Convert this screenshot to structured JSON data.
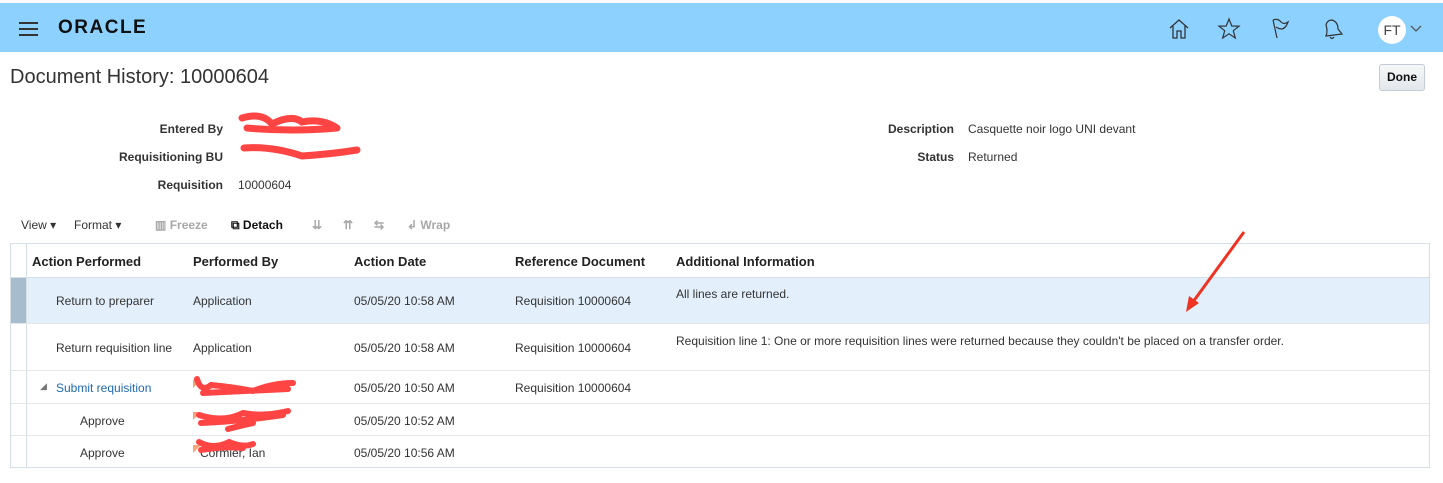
{
  "header": {
    "logo": "ORACLE",
    "avatar": "FT",
    "icons": [
      "menu-icon",
      "home-icon",
      "favorites-star-icon",
      "flag-icon",
      "notifications-bell-icon",
      "chevron-down-icon"
    ]
  },
  "page": {
    "title": "Document History: 10000604",
    "done_label": "Done"
  },
  "form": {
    "left": [
      {
        "label": "Entered By",
        "value": ""
      },
      {
        "label": "Requisitioning BU",
        "value": ""
      },
      {
        "label": "Requisition",
        "value": "10000604"
      }
    ],
    "right": [
      {
        "label": "Description",
        "value": "Casquette noir logo UNI devant"
      },
      {
        "label": "Status",
        "value": "Returned"
      }
    ]
  },
  "toolbar": {
    "view": "View",
    "format": "Format",
    "freeze": "Freeze",
    "detach": "Detach",
    "wrap": "Wrap"
  },
  "table": {
    "columns": [
      "Action Performed",
      "Performed By",
      "Action Date",
      "Reference Document",
      "Additional Information"
    ],
    "rows": [
      {
        "action": "Return to preparer",
        "by": "Application",
        "date": "05/05/20 10:58 AM",
        "ref": "Requisition 10000604",
        "info": "All lines are returned."
      },
      {
        "action": "Return requisition line",
        "by": "Application",
        "date": "05/05/20 10:58 AM",
        "ref": "Requisition 10000604",
        "info": "Requisition line 1: One or more requisition lines were returned because they couldn't be placed on a transfer order."
      },
      {
        "action": "Submit requisition",
        "by": "",
        "date": "05/05/20 10:50 AM",
        "ref": "Requisition 10000604",
        "info": ""
      },
      {
        "action": "Approve",
        "by": "",
        "date": "05/05/20 10:52 AM",
        "ref": "",
        "info": ""
      },
      {
        "action": "Approve",
        "by": "Cormier, Ian",
        "date": "05/05/20 10:56 AM",
        "ref": "",
        "info": ""
      }
    ]
  }
}
